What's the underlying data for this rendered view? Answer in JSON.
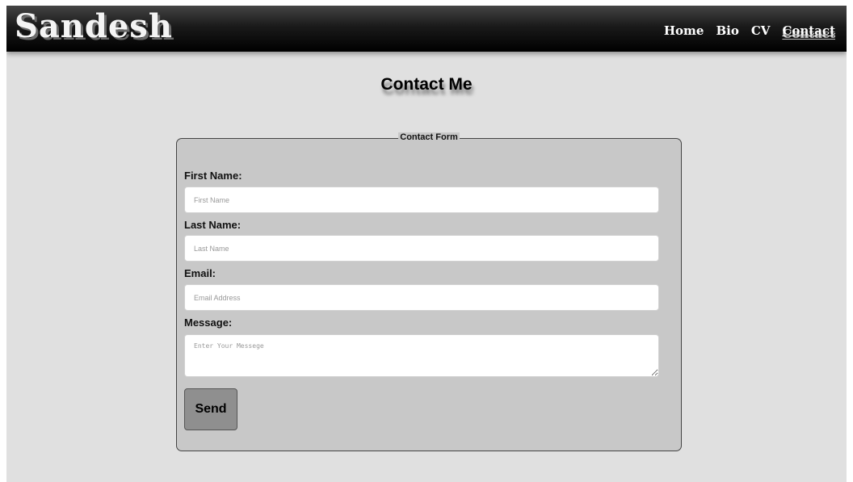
{
  "header": {
    "brand": "Sandesh",
    "nav": [
      {
        "label": "Home"
      },
      {
        "label": "Bio"
      },
      {
        "label": "CV"
      },
      {
        "label": "Contact",
        "active": true
      }
    ]
  },
  "page": {
    "title": "Contact Me"
  },
  "form": {
    "legend": "Contact Form",
    "first_name": {
      "label": "First Name:",
      "placeholder": "First Name",
      "value": ""
    },
    "last_name": {
      "label": "Last Name:",
      "placeholder": "Last Name",
      "value": ""
    },
    "email": {
      "label": "Email:",
      "placeholder": "Email Address",
      "value": ""
    },
    "message": {
      "label": "Message:",
      "placeholder": "Enter Your Messege",
      "value": ""
    },
    "send_label": "Send"
  },
  "colors": {
    "header_bg": "#000000",
    "page_bg": "#e0e0e0",
    "form_bg": "#c8c8c8",
    "button_bg": "#8f8f8f"
  }
}
